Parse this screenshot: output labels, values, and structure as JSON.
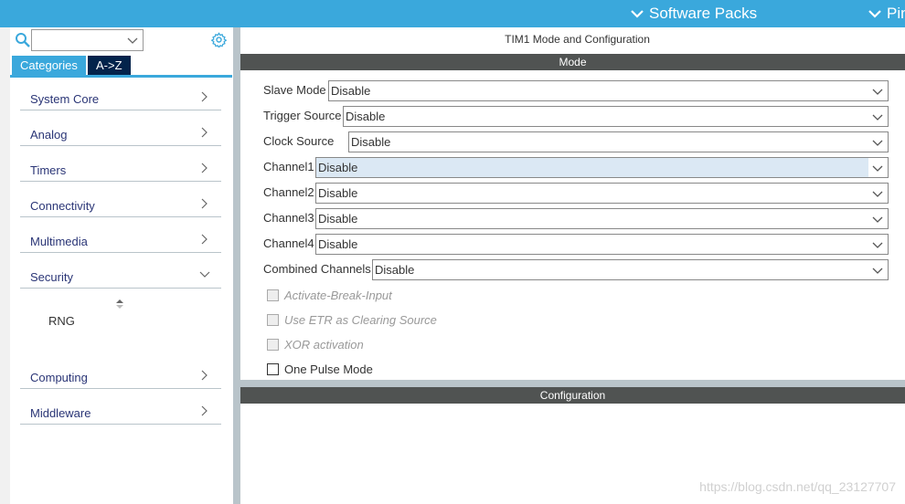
{
  "topbar": {
    "tabs": [
      {
        "label": "Software Packs"
      },
      {
        "label": "Pinout"
      }
    ]
  },
  "sidebar": {
    "search": {
      "value": "",
      "placeholder": ""
    },
    "tabs": [
      {
        "label": "Categories",
        "active": true
      },
      {
        "label": "A->Z",
        "active": false
      }
    ],
    "categories": [
      {
        "label": "System Core",
        "expanded": false
      },
      {
        "label": "Analog",
        "expanded": false
      },
      {
        "label": "Timers",
        "expanded": false
      },
      {
        "label": "Connectivity",
        "expanded": false
      },
      {
        "label": "Multimedia",
        "expanded": false
      },
      {
        "label": "Security",
        "expanded": true,
        "children": [
          "RNG"
        ]
      },
      {
        "label": "Computing",
        "expanded": false
      },
      {
        "label": "Middleware",
        "expanded": false
      }
    ]
  },
  "main": {
    "title": "TIM1 Mode and Configuration",
    "mode_header": "Mode",
    "fields": [
      {
        "label": "Slave Mode",
        "value": "Disable"
      },
      {
        "label": "Trigger Source",
        "value": "Disable"
      },
      {
        "label": "Clock Source",
        "value": "Disable"
      },
      {
        "label": "Channel1",
        "value": "Disable",
        "focused": true
      },
      {
        "label": "Channel2",
        "value": "Disable"
      },
      {
        "label": "Channel3",
        "value": "Disable"
      },
      {
        "label": "Channel4",
        "value": "Disable"
      },
      {
        "label": "Combined Channels",
        "value": "Disable"
      }
    ],
    "checkboxes": [
      {
        "label": "Activate-Break-Input",
        "checked": false,
        "enabled": false
      },
      {
        "label": "Use ETR as Clearing Source",
        "checked": false,
        "enabled": false
      },
      {
        "label": "XOR activation",
        "checked": false,
        "enabled": false
      },
      {
        "label": "One Pulse Mode",
        "checked": false,
        "enabled": true
      }
    ],
    "config_header": "Configuration"
  },
  "watermark": "https://blog.csdn.net/qq_23127707",
  "colors": {
    "accent": "#3aa8dc",
    "header_dark": "#505352",
    "nav_dark": "#03234b"
  }
}
